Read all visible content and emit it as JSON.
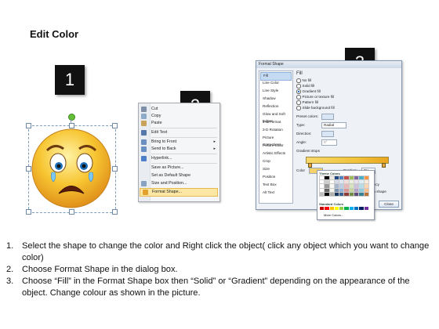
{
  "title": "Edit Color",
  "badges": [
    "1",
    "2",
    "3"
  ],
  "context_menu": {
    "items": [
      "Cut",
      "Copy",
      "Paste",
      "Edit Text",
      "Bring to Front",
      "Send to Back",
      "Hyperlink...",
      "Save as Picture...",
      "Set as Default Shape",
      "Size and Position...",
      "Format Shape..."
    ],
    "highlighted": "Format Shape..."
  },
  "dialog": {
    "title": "Format Shape",
    "nav": [
      "Fill",
      "Line Color",
      "Line Style",
      "Shadow",
      "Reflection",
      "Glow and Soft Edges",
      "3-D Format",
      "3-D Rotation",
      "Picture Corrections",
      "Picture Color",
      "Artistic Effects",
      "Crop",
      "Size",
      "Position",
      "Text Box",
      "Alt Text"
    ],
    "selected_nav": "Fill",
    "fill_heading": "Fill",
    "fill_options": [
      "No fill",
      "Solid fill",
      "Gradient fill",
      "Picture or texture fill",
      "Pattern fill",
      "Slide background fill"
    ],
    "selected_fill": "Gradient fill",
    "preset_colors_label": "Preset colors:",
    "type_label": "Type:",
    "type_value": "Radial",
    "direction_label": "Direction:",
    "angle_label": "Angle:",
    "angle_value": "0°",
    "gradient_stops_label": "Gradient stops",
    "color_label": "Color",
    "position_label": "Position:",
    "position_value": "0%",
    "brightness_label": "Brightness",
    "transparency_label": "Transparency",
    "rotate_label": "Rotate with shape",
    "close_label": "Close"
  },
  "picker": {
    "theme_label": "Theme Colors",
    "standard_label": "Standard Colors",
    "more_label": "More Colors...",
    "theme_top": [
      "#ffffff",
      "#000000",
      "#eeece1",
      "#1f497d",
      "#4f81bd",
      "#c0504d",
      "#9bbb59",
      "#8064a2",
      "#4bacc6",
      "#f79646"
    ],
    "standard": [
      "#c00000",
      "#ff0000",
      "#ffc000",
      "#ffff00",
      "#92d050",
      "#00b050",
      "#00b0f0",
      "#0070c0",
      "#002060",
      "#7030a0"
    ]
  },
  "steps": [
    {
      "n": "1.",
      "text": "Select the shape to change the color and Right click the object( click any object which you want to change color)"
    },
    {
      "n": "2.",
      "text": "Choose Format Shape in the dialog box."
    },
    {
      "n": "3.",
      "text": "Choose “Fill” in the Format Shape box then “Solid” or “Gradient” depending on the appearance of the object. Change colour as shown in the picture."
    }
  ]
}
